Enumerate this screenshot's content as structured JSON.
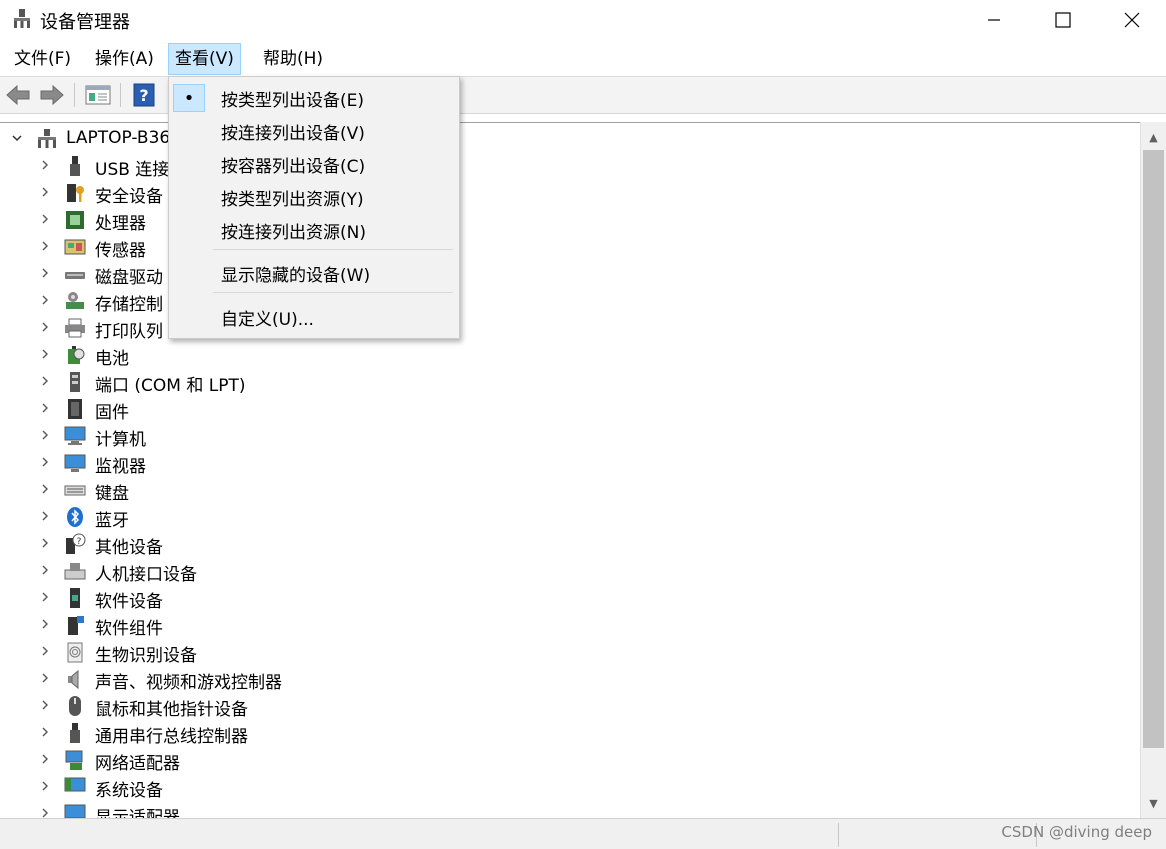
{
  "window": {
    "title": "设备管理器"
  },
  "menu": {
    "items": [
      {
        "label": "文件(F)"
      },
      {
        "label": "操作(A)"
      },
      {
        "label": "查看(V)"
      },
      {
        "label": "帮助(H)"
      }
    ]
  },
  "view_menu": {
    "group1": [
      {
        "label": "按类型列出设备(E)",
        "checked": true
      },
      {
        "label": "按连接列出设备(V)"
      },
      {
        "label": "按容器列出设备(C)"
      },
      {
        "label": "按类型列出资源(Y)"
      },
      {
        "label": "按连接列出资源(N)"
      }
    ],
    "group2": [
      {
        "label": "显示隐藏的设备(W)"
      }
    ],
    "group3": [
      {
        "label": "自定义(U)..."
      }
    ]
  },
  "tree": {
    "root": "LAPTOP-B36",
    "categories": [
      {
        "label": "USB 连接",
        "icon": "usb-icon"
      },
      {
        "label": "安全设备",
        "icon": "security-key-icon"
      },
      {
        "label": "处理器",
        "icon": "cpu-icon"
      },
      {
        "label": "传感器",
        "icon": "sensor-icon"
      },
      {
        "label": "磁盘驱动",
        "icon": "disk-icon"
      },
      {
        "label": "存储控制",
        "icon": "storage-controller-icon"
      },
      {
        "label": "打印队列",
        "icon": "printer-icon"
      },
      {
        "label": "电池",
        "icon": "battery-icon"
      },
      {
        "label": "端口 (COM 和 LPT)",
        "icon": "port-icon"
      },
      {
        "label": "固件",
        "icon": "firmware-icon"
      },
      {
        "label": "计算机",
        "icon": "computer-icon"
      },
      {
        "label": "监视器",
        "icon": "monitor-icon"
      },
      {
        "label": "键盘",
        "icon": "keyboard-icon"
      },
      {
        "label": "蓝牙",
        "icon": "bluetooth-icon"
      },
      {
        "label": "其他设备",
        "icon": "unknown-device-icon"
      },
      {
        "label": "人机接口设备",
        "icon": "hid-icon"
      },
      {
        "label": "软件设备",
        "icon": "software-device-icon"
      },
      {
        "label": "软件组件",
        "icon": "software-component-icon"
      },
      {
        "label": "生物识别设备",
        "icon": "fingerprint-icon"
      },
      {
        "label": "声音、视频和游戏控制器",
        "icon": "speaker-icon"
      },
      {
        "label": "鼠标和其他指针设备",
        "icon": "mouse-icon"
      },
      {
        "label": "通用串行总线控制器",
        "icon": "usb-controller-icon"
      },
      {
        "label": "网络适配器",
        "icon": "network-adapter-icon"
      },
      {
        "label": "系统设备",
        "icon": "system-device-icon"
      },
      {
        "label": "显示适配器",
        "icon": "display-adapter-icon"
      }
    ]
  },
  "statusbar": {
    "watermark": "CSDN @diving deep"
  }
}
